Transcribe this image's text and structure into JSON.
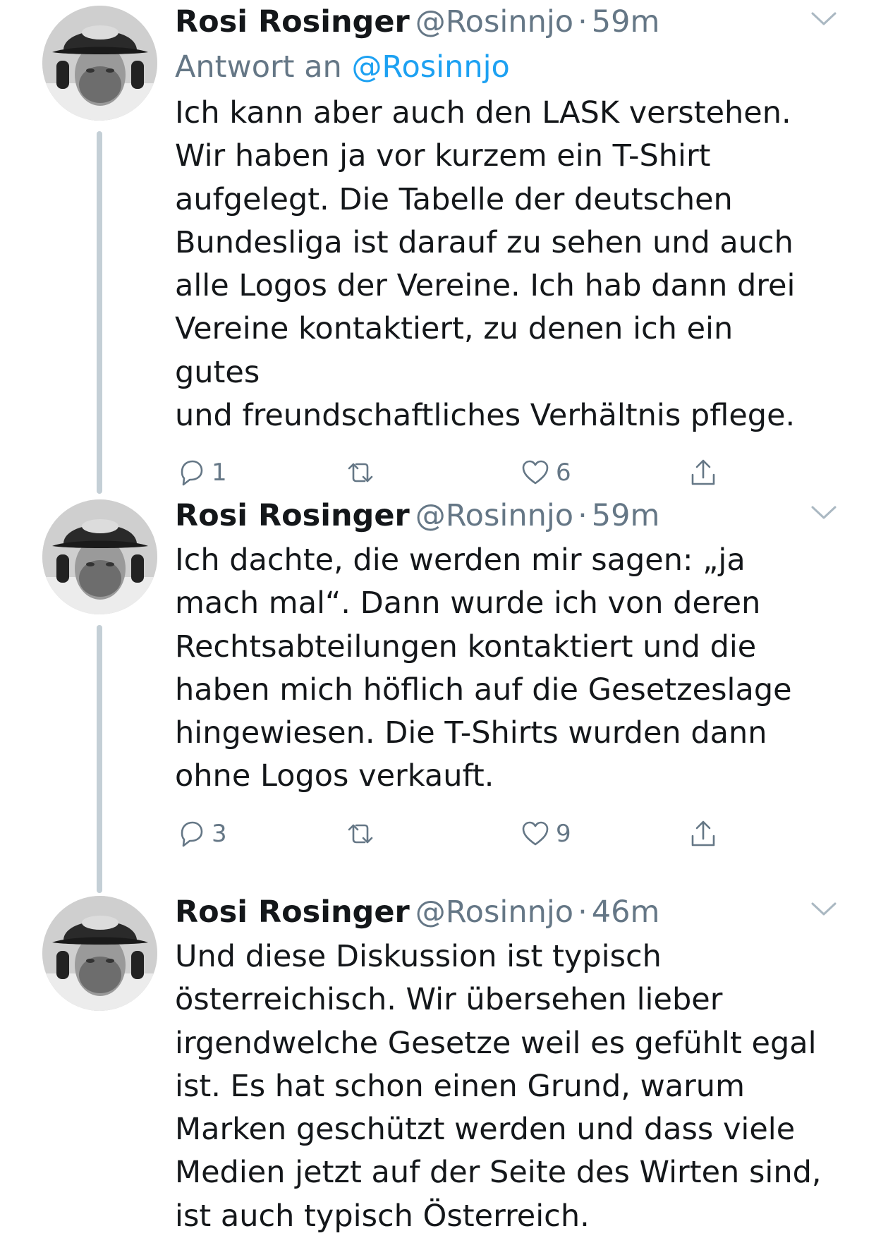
{
  "colors": {
    "text": "#14171a",
    "secondary": "#657786",
    "link": "#1da1f2",
    "thread_line": "#c4cfd6"
  },
  "tweets": [
    {
      "name": "Rosi Rosinger",
      "handle": "@Rosinnjo",
      "separator": "·",
      "time": "59m",
      "reply_prefix": "Antwort an",
      "reply_handle": "@Rosinnjo",
      "text": "Ich kann aber auch den LASK verstehen.\nWir haben ja vor kurzem ein T-Shirt\naufgelegt. Die Tabelle der deutschen\nBundesliga ist darauf zu sehen und auch\nalle Logos der Vereine. Ich hab dann drei\nVereine kontaktiert, zu denen ich ein gutes\nund freundschaftliches Verhältnis pflege.",
      "reply_count": "1",
      "retweet_count": "",
      "like_count": "6",
      "icons": [
        "reply-icon",
        "retweet-icon",
        "like-icon",
        "share-icon",
        "chevron-down-icon"
      ]
    },
    {
      "name": "Rosi Rosinger",
      "handle": "@Rosinnjo",
      "separator": "·",
      "time": "59m",
      "text": "Ich dachte, die werden mir sagen: „ja\nmach mal“. Dann wurde ich von deren\nRechtsabteilungen kontaktiert und die\nhaben mich höflich auf die Gesetzeslage\nhingewiesen. Die T-Shirts wurden dann\nohne Logos verkauft.",
      "reply_count": "3",
      "retweet_count": "",
      "like_count": "9",
      "icons": [
        "reply-icon",
        "retweet-icon",
        "like-icon",
        "share-icon",
        "chevron-down-icon"
      ]
    },
    {
      "name": "Rosi Rosinger",
      "handle": "@Rosinnjo",
      "separator": "·",
      "time": "46m",
      "text": "Und diese Diskussion ist typisch\nösterreichisch. Wir übersehen lieber\nirgendwelche Gesetze weil es gefühlt egal\nist. Es hat schon einen Grund, warum\nMarken geschützt werden und dass viele\nMedien jetzt auf der Seite des Wirten sind,\nist auch typisch Österreich.",
      "icons": [
        "chevron-down-icon"
      ]
    }
  ]
}
